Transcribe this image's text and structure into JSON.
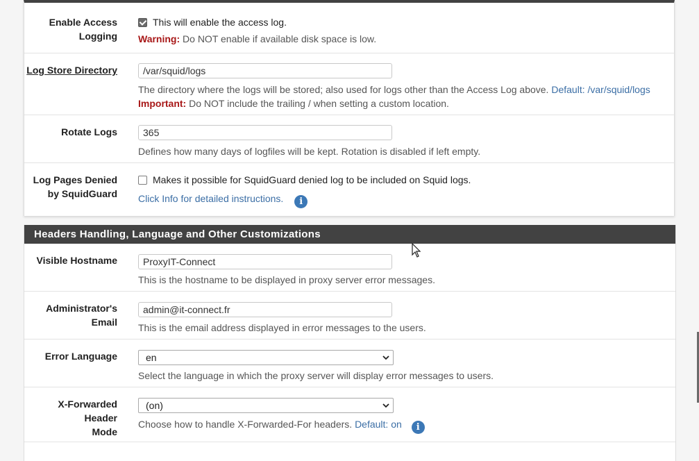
{
  "logging": {
    "enable_access_logging": {
      "label_line1": "Enable Access",
      "label_line2": "Logging",
      "checked": true,
      "checkbox_text": "This will enable the access log.",
      "warning_label": "Warning:",
      "warning_text": " Do NOT enable if available disk space is low."
    },
    "log_store_directory": {
      "label": "Log Store Directory",
      "value": "/var/squid/logs",
      "help": "The directory where the logs will be stored; also used for logs other than the Access Log above. ",
      "default_text": "Default: /var/squid/logs",
      "important_label": "Important:",
      "important_text": " Do NOT include the trailing / when setting a custom location."
    },
    "rotate_logs": {
      "label": "Rotate Logs",
      "value": "365",
      "help": "Defines how many days of logfiles will be kept. Rotation is disabled if left empty."
    },
    "log_pages_denied": {
      "label_line1": "Log Pages Denied",
      "label_line2": "by SquidGuard",
      "checked": false,
      "checkbox_text": "Makes it possible for SquidGuard denied log to be included on Squid logs.",
      "info_link": "Click Info for detailed instructions."
    }
  },
  "headers_section": {
    "title": "Headers Handling, Language and Other Customizations",
    "visible_hostname": {
      "label": "Visible Hostname",
      "value": "ProxyIT-Connect",
      "help": "This is the hostname to be displayed in proxy server error messages."
    },
    "admin_email": {
      "label_line1": "Administrator's",
      "label_line2": "Email",
      "value": "admin@it-connect.fr",
      "help": "This is the email address displayed in error messages to the users."
    },
    "error_language": {
      "label": "Error Language",
      "value": "en",
      "help": "Select the language in which the proxy server will display error messages to users."
    },
    "x_forwarded": {
      "label_line1": "X-Forwarded Header",
      "label_line2": "Mode",
      "value": "(on)",
      "help": "Choose how to handle X-Forwarded-For headers. ",
      "default_text": "Default: on"
    }
  },
  "icons": {
    "info": "info-icon",
    "dropdown": "chevron-down-icon",
    "cursor": "mouse-pointer-icon"
  },
  "colors": {
    "panel_heading": "#424242",
    "warning": "#a81818",
    "link": "#3b6ea5",
    "info_icon": "#3c78b6"
  }
}
